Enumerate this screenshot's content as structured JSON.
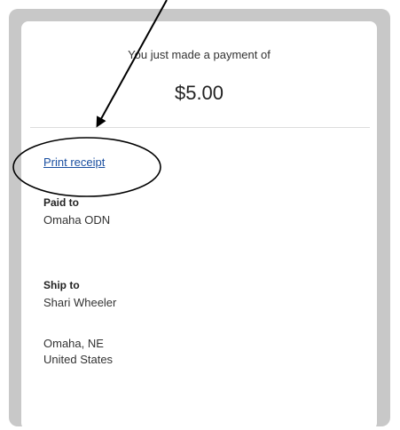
{
  "payment": {
    "intro": "You just made a payment of",
    "amount": "$5.00"
  },
  "actions": {
    "print_receipt": "Print receipt"
  },
  "paid_to": {
    "label": "Paid to",
    "name": "Omaha ODN"
  },
  "ship_to": {
    "label": "Ship to",
    "name": "Shari Wheeler",
    "city_state": "Omaha, NE",
    "country": "United States"
  },
  "colors": {
    "link": "#1a4fa0",
    "frame": "#c8c8c8"
  }
}
